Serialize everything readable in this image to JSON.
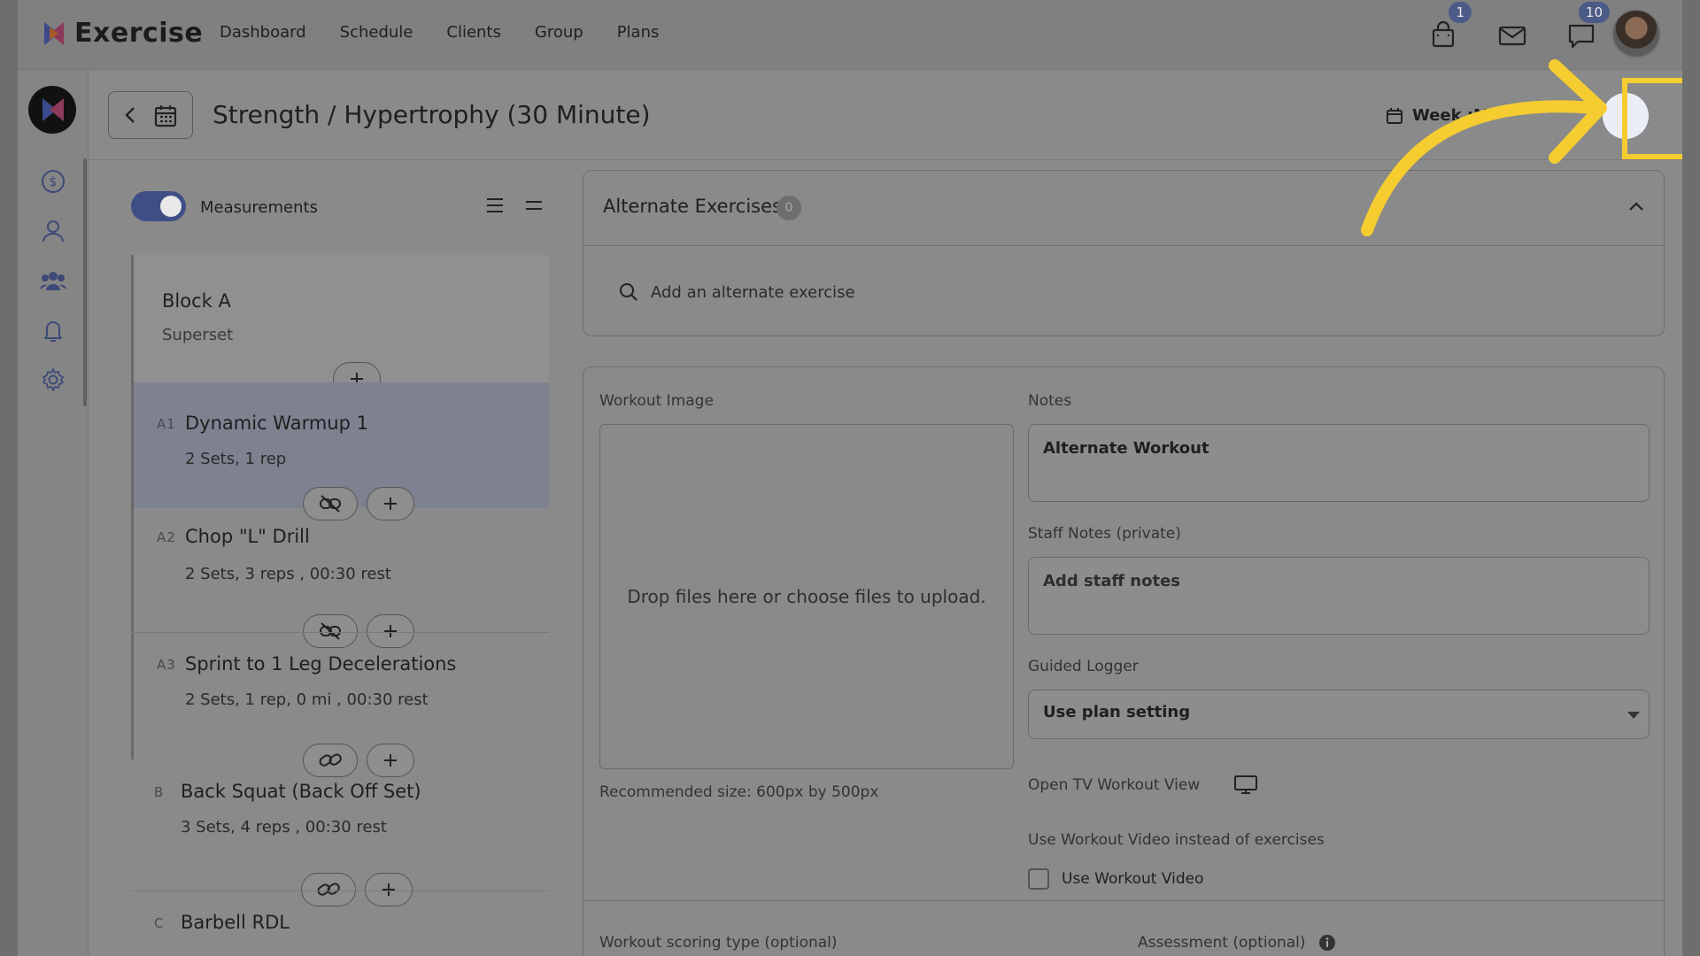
{
  "app": {
    "name": "Exercise"
  },
  "nav": [
    "Dashboard",
    "Schedule",
    "Clients",
    "Group",
    "Plans"
  ],
  "badges": {
    "cart": "1",
    "chat": "10"
  },
  "sidebar_icons": [
    "dollar-icon",
    "user-icon",
    "users-icon",
    "bell-icon",
    "gear-icon"
  ],
  "header": {
    "title": "Strength / Hypertrophy (30 Minute)",
    "week_label": "Week :M"
  },
  "left": {
    "measurements_label": "Measurements",
    "block": {
      "title": "Block A",
      "subtitle": "Superset"
    },
    "exercises": [
      {
        "code": "A1",
        "name": "Dynamic Warmup 1",
        "meta": "2 Sets, 1 rep"
      },
      {
        "code": "A2",
        "name": "Chop \"L\" Drill",
        "meta": "2 Sets, 3 reps , 00:30 rest"
      },
      {
        "code": "A3",
        "name": "Sprint to 1 Leg Decelerations",
        "meta": "2 Sets, 1 rep, 0 mi , 00:30 rest"
      },
      {
        "code": "B",
        "name": "Back Squat (Back Off Set)",
        "meta": "3 Sets, 4 reps , 00:30 rest"
      },
      {
        "code": "C",
        "name": "Barbell RDL",
        "meta": ""
      }
    ]
  },
  "alternate": {
    "title": "Alternate Exercises",
    "count": "0",
    "search_placeholder": "Add an alternate exercise"
  },
  "workout": {
    "image_label": "Workout Image",
    "drop_text": "Drop files here or choose files to upload.",
    "recommended": "Recommended size: 600px by 500px",
    "notes_label": "Notes",
    "notes_value": "Alternate Workout",
    "staff_notes_label": "Staff Notes (private)",
    "staff_notes_placeholder": "Add staff notes",
    "guided_logger_label": "Guided Logger",
    "guided_logger_value": "Use plan setting",
    "tv_view_label": "Open TV Workout View",
    "video_label": "Use Workout Video instead of exercises",
    "video_checkbox": "Use Workout Video",
    "scoring_label": "Workout scoring type (optional)",
    "assessment_label": "Assessment (optional)"
  },
  "colors": {
    "highlight": "#f5cd30",
    "toggle": "#3f4f86"
  }
}
